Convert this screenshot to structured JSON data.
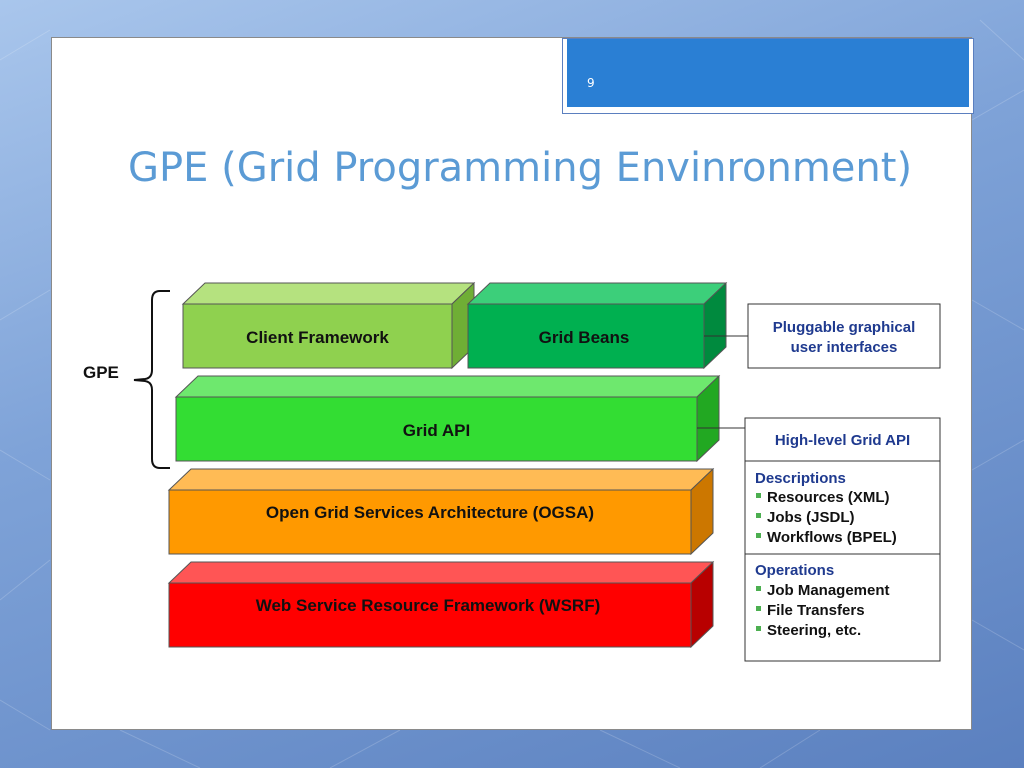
{
  "slide": {
    "number": "9",
    "title": "GPE (Grid Programming Envinronment)"
  },
  "diagram": {
    "bracket_label": "GPE",
    "layers": {
      "client_framework": "Client Framework",
      "grid_beans": "Grid Beans",
      "grid_api": "Grid API",
      "ogsa": "Open Grid Services Architecture (OGSA)",
      "wsrf": "Web Service Resource Framework (WSRF)"
    },
    "callouts": {
      "pluggable_line1": "Pluggable graphical",
      "pluggable_line2": "user interfaces",
      "high_level": "High-level Grid API",
      "descriptions": {
        "heading": "Descriptions",
        "items": [
          "Resources (XML)",
          "Jobs (JSDL)",
          "Workflows (BPEL)"
        ]
      },
      "operations": {
        "heading": "Operations",
        "items": [
          "Job Management",
          "File Transfers",
          "Steering, etc."
        ]
      }
    },
    "colors": {
      "client_framework": "#8fd14f",
      "grid_beans": "#00b050",
      "grid_api": "#33dd33",
      "ogsa": "#ff9900",
      "wsrf": "#ff0000",
      "callout_text": "#1f3a8f"
    }
  }
}
